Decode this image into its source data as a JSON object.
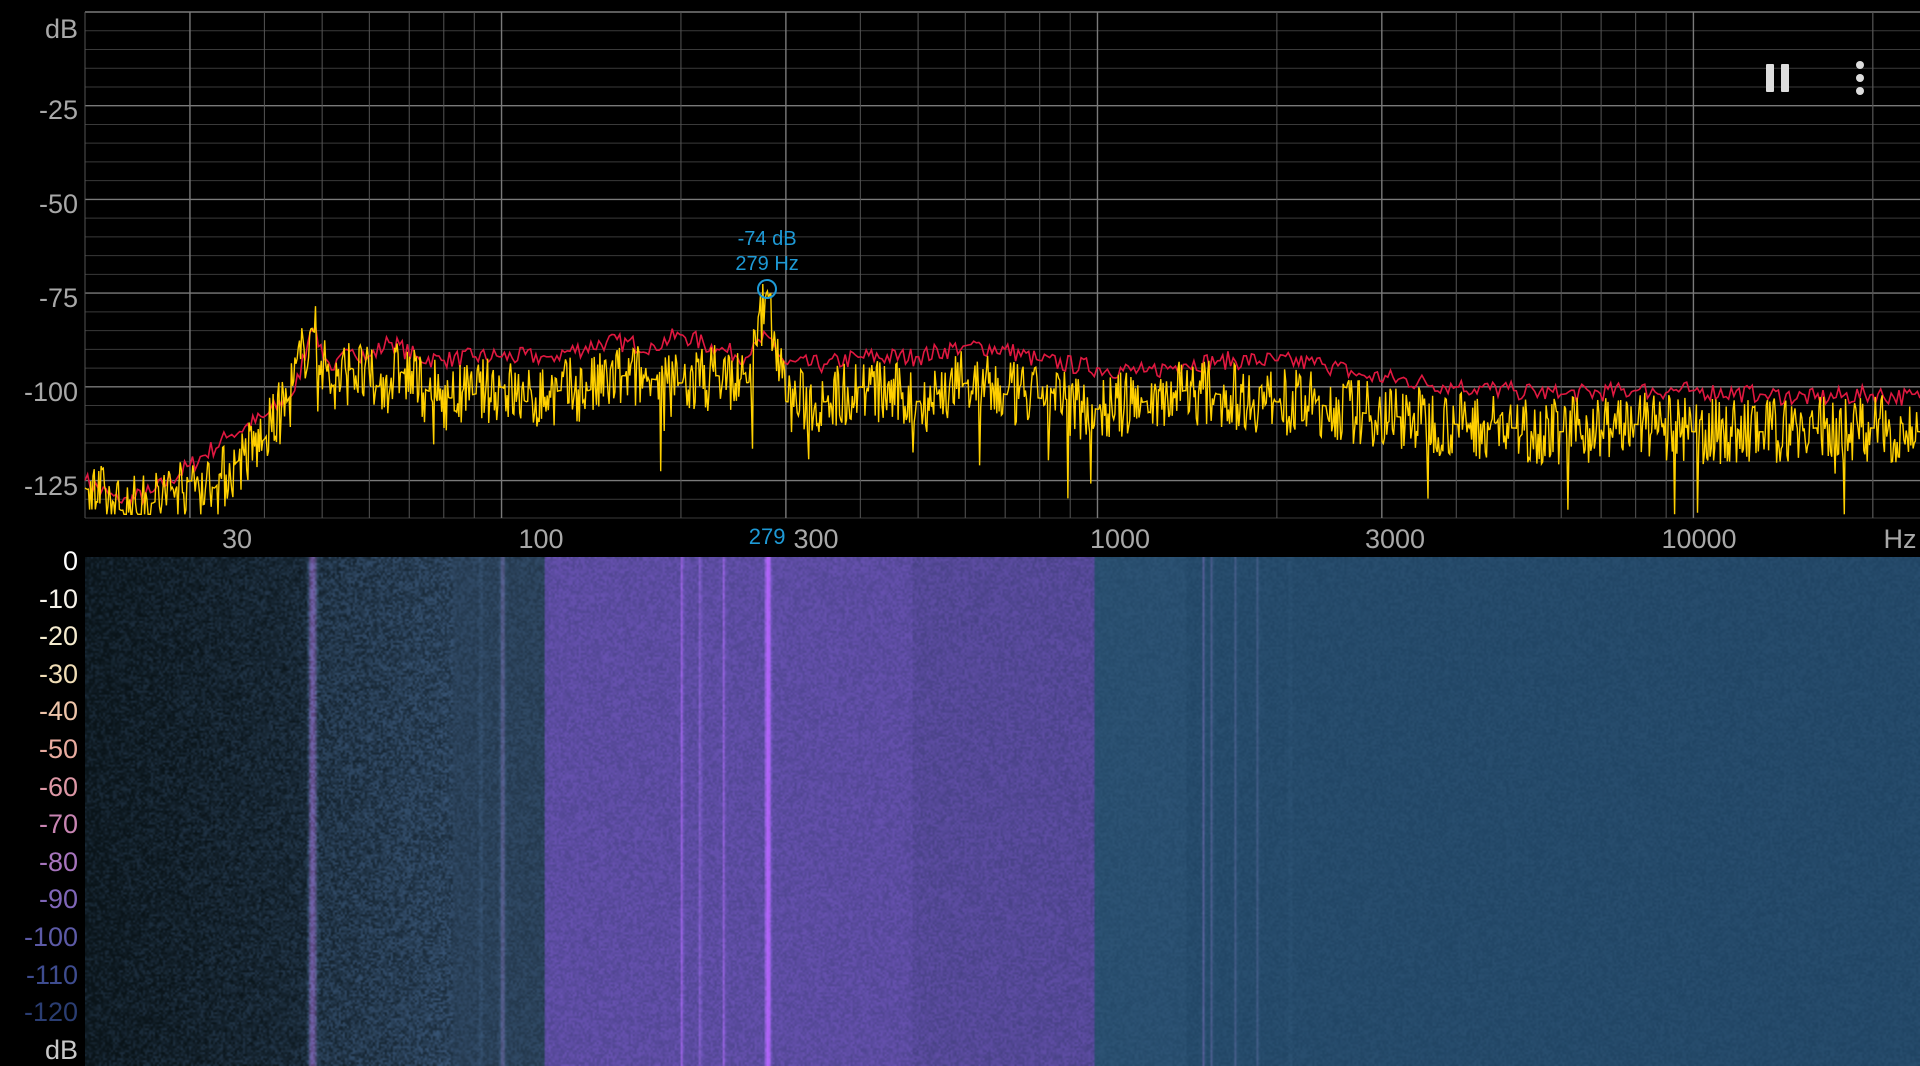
{
  "controls": {
    "pause_icon": "pause-icon",
    "menu_icon": "more-vert-icon"
  },
  "colors": {
    "background": "#000000",
    "grid_major": "#7a7a7a",
    "grid_minor": "#3a3a3a",
    "peak_hold_trace": "#e01840",
    "live_trace": "#ffd000",
    "marker": "#1e9ad6"
  },
  "spectrum": {
    "y_unit": "dB",
    "y_ticks": [
      "-25",
      "-50",
      "-75",
      "-100",
      "-125"
    ],
    "x_unit": "Hz",
    "x_ticks": [
      "30",
      "100",
      "300",
      "1000",
      "3000",
      "10000"
    ],
    "peak": {
      "db_label": "-74 dB",
      "hz_label": "279 Hz",
      "cursor_label": "279"
    }
  },
  "spectrogram": {
    "scale_unit": "dB",
    "scale_labels": [
      {
        "text": "0",
        "color": "#ffffff"
      },
      {
        "text": "-10",
        "color": "#f6f2ea"
      },
      {
        "text": "-20",
        "color": "#f5eccf"
      },
      {
        "text": "-30",
        "color": "#f0ddb6"
      },
      {
        "text": "-40",
        "color": "#edc4a9"
      },
      {
        "text": "-50",
        "color": "#e8ab9f"
      },
      {
        "text": "-60",
        "color": "#dc97a5"
      },
      {
        "text": "-70",
        "color": "#c985b3"
      },
      {
        "text": "-80",
        "color": "#a674bd"
      },
      {
        "text": "-90",
        "color": "#7f66b8"
      },
      {
        "text": "-100",
        "color": "#5c5aa6"
      },
      {
        "text": "-110",
        "color": "#3e4c8f"
      },
      {
        "text": "-120",
        "color": "#2a3d72"
      }
    ]
  },
  "chart_data": {
    "type": "line",
    "x_scale": "log",
    "xlim": [
      20,
      24000
    ],
    "ylim": [
      -135,
      0
    ],
    "xlabel": "Hz",
    "ylabel": "dB",
    "grid": true,
    "series": [
      {
        "color": "#e01840",
        "x": [
          20,
          23,
          26,
          30,
          35,
          40,
          45,
          48,
          52,
          56,
          60,
          65,
          72,
          80,
          90,
          100,
          120,
          150,
          180,
          200,
          230,
          260,
          279,
          300,
          350,
          400,
          500,
          600,
          700,
          800,
          1000,
          1200,
          1400,
          1600,
          2000,
          2400,
          2800,
          3200,
          4000,
          5000,
          6000,
          8000,
          10000,
          13000,
          16000,
          20000,
          24000
        ],
        "y": [
          -125,
          -131,
          -128,
          -121,
          -113,
          -108,
          -101,
          -84,
          -96,
          -90,
          -92,
          -88,
          -92,
          -93,
          -92,
          -92,
          -92,
          -88,
          -89,
          -86,
          -90,
          -92,
          -86,
          -94,
          -94,
          -92,
          -92,
          -89,
          -90,
          -93,
          -95,
          -96,
          -94,
          -93,
          -93,
          -94,
          -97,
          -98,
          -100,
          -101,
          -102,
          -101,
          -101,
          -102,
          -103,
          -102,
          -103
        ]
      },
      {
        "color": "#ffd000",
        "x": [
          20,
          23,
          26,
          30,
          33,
          36,
          40,
          44,
          48,
          52,
          56,
          62,
          68,
          75,
          82,
          90,
          100,
          110,
          125,
          140,
          160,
          180,
          200,
          230,
          260,
          279,
          300,
          350,
          400,
          500,
          600,
          700,
          800,
          1000,
          1200,
          1400,
          1600,
          2000,
          2400,
          2800,
          3200,
          4000,
          5000,
          6000,
          8000,
          10000,
          13000,
          16000,
          20000,
          24000
        ],
        "y": [
          -127,
          -133,
          -131,
          -125,
          -127,
          -120,
          -114,
          -103,
          -84,
          -100,
          -95,
          -100,
          -96,
          -101,
          -103,
          -102,
          -100,
          -104,
          -101,
          -101,
          -97,
          -98,
          -99,
          -97,
          -99,
          -74,
          -104,
          -104,
          -100,
          -104,
          -99,
          -102,
          -103,
          -106,
          -104,
          -101,
          -102,
          -104,
          -105,
          -107,
          -108,
          -110,
          -111,
          -112,
          -110,
          -112,
          -112,
          -111,
          -111,
          -112
        ]
      }
    ],
    "annotations": [
      {
        "label": "-74 dB",
        "x": 279,
        "y": -74
      },
      {
        "label": "279 Hz",
        "x": 279,
        "y": -74
      }
    ]
  }
}
